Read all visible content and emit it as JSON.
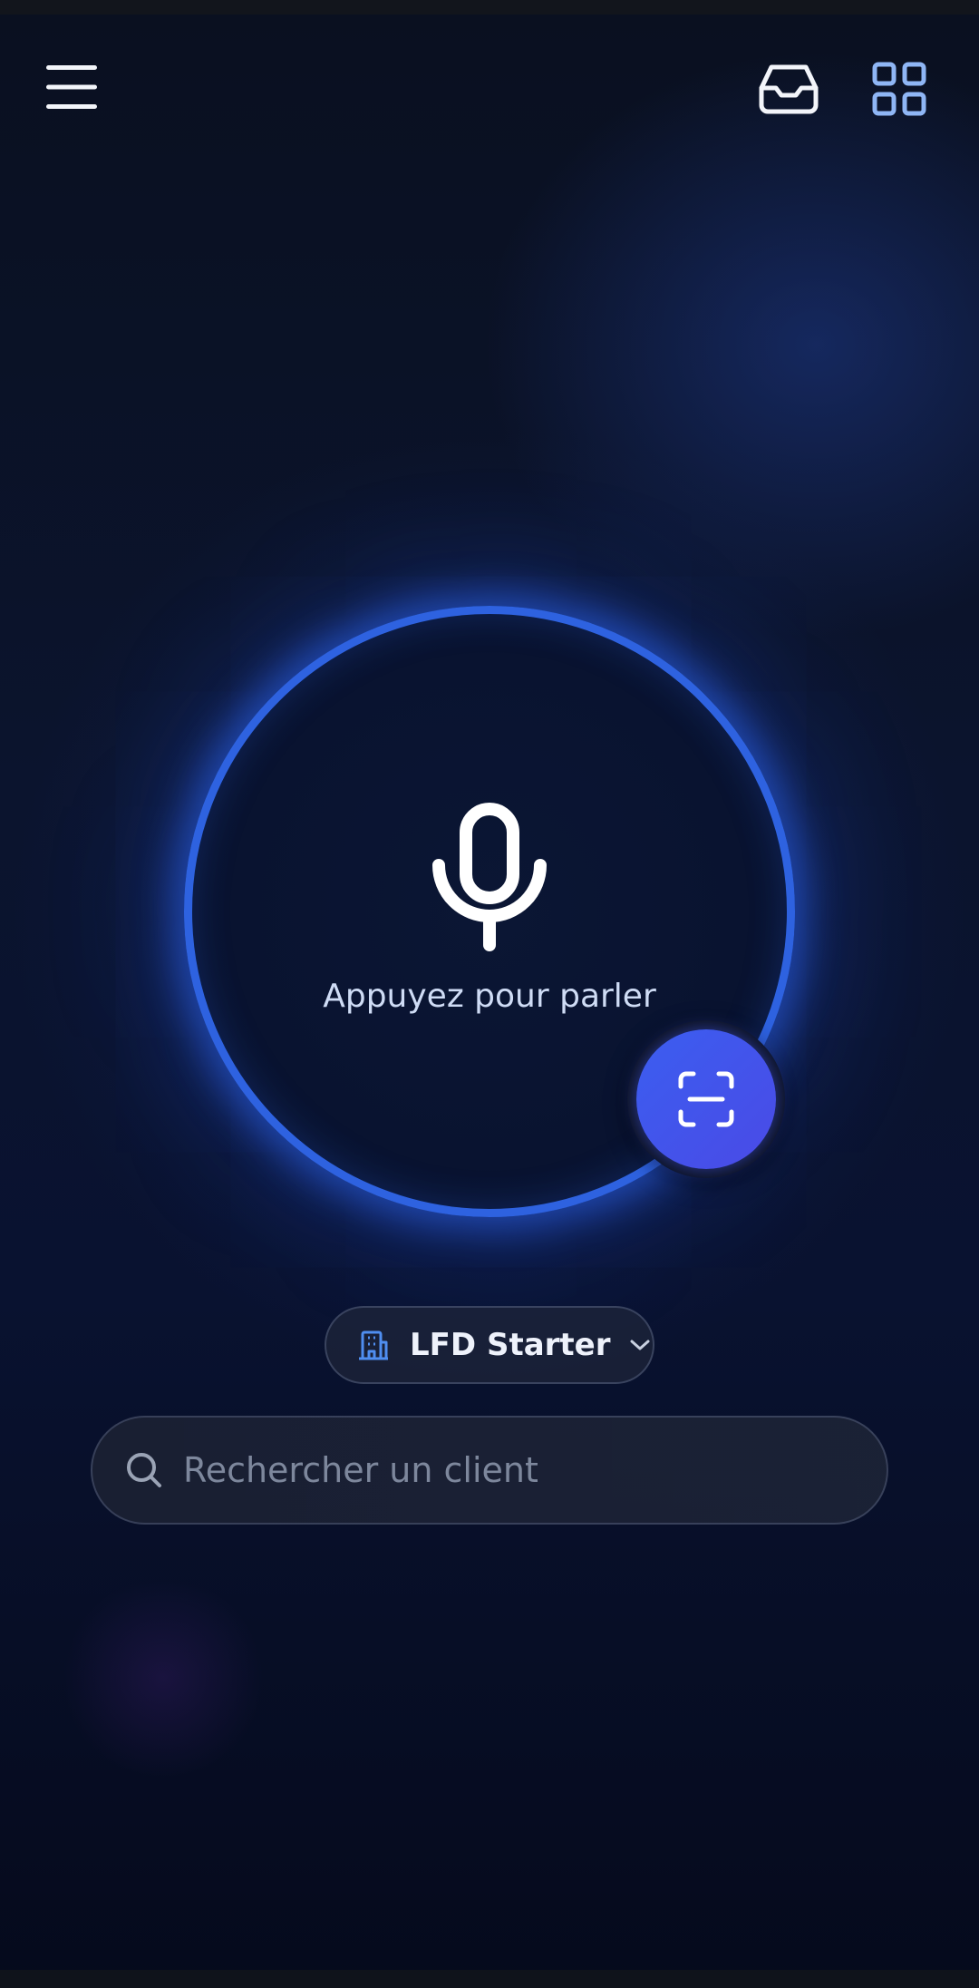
{
  "header": {
    "menu_icon": "hamburger-menu-icon",
    "inbox_icon": "inbox-tray-icon",
    "apps_icon": "grid-apps-icon"
  },
  "voice": {
    "label": "Appuyez pour parler",
    "icon": "microphone-icon",
    "ring_color": "#2e62e0"
  },
  "scan": {
    "icon": "scan-frame-icon",
    "color": "#3b5ef0"
  },
  "workspace": {
    "name": "LFD Starter",
    "icon": "building-icon",
    "chevron": "chevron-down-icon"
  },
  "search": {
    "placeholder": "Rechercher un client",
    "value": "",
    "icon": "search-icon"
  }
}
